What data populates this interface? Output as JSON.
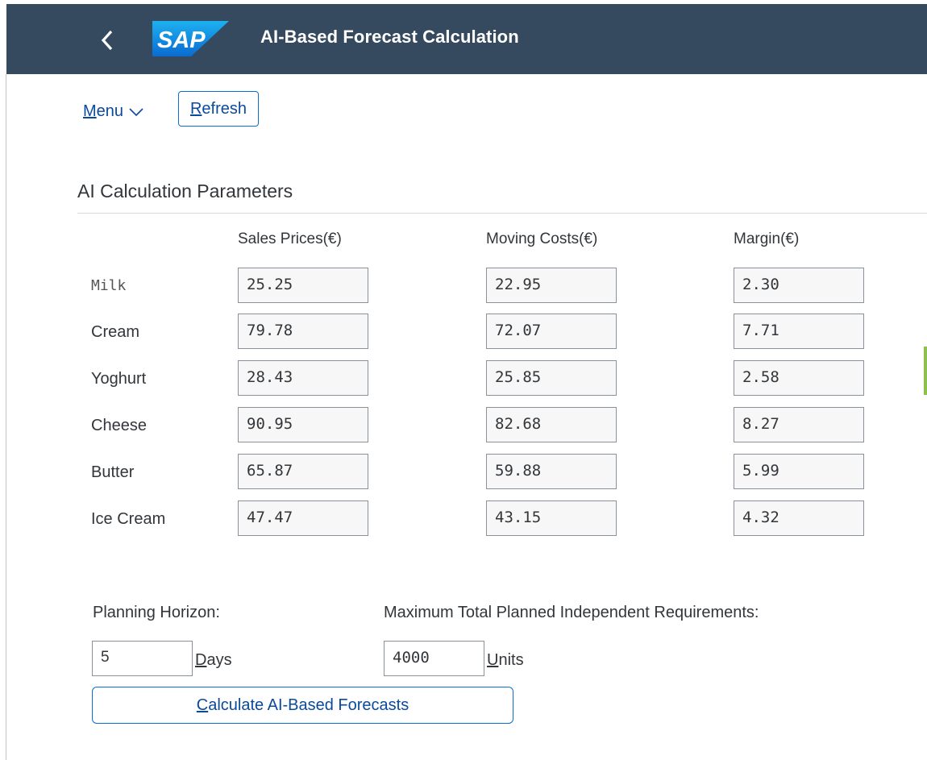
{
  "shell": {
    "title": "AI-Based Forecast Calculation",
    "logo_text": "SAP",
    "back_icon": "chevron-left-icon",
    "bg_color": "#354a5f"
  },
  "toolbar": {
    "menu_label": "Menu",
    "menu_icon": "chevron-down-icon",
    "refresh_label": "Refresh"
  },
  "section": {
    "title": "AI Calculation Parameters"
  },
  "table": {
    "columns": [
      "Sales Prices(€)",
      "Moving Costs(€)",
      "Margin(€)"
    ],
    "rows": [
      {
        "label": "Milk",
        "sales": "25.25",
        "costs": "22.95",
        "margin": "2.30"
      },
      {
        "label": "Cream",
        "sales": "79.78",
        "costs": "72.07",
        "margin": "7.71"
      },
      {
        "label": "Yoghurt",
        "sales": "28.43",
        "costs": "25.85",
        "margin": "2.58"
      },
      {
        "label": "Cheese",
        "sales": "90.95",
        "costs": "82.68",
        "margin": "8.27"
      },
      {
        "label": "Butter",
        "sales": "65.87",
        "costs": "59.88",
        "margin": "5.99"
      },
      {
        "label": "Ice Cream",
        "sales": "47.47",
        "costs": "43.15",
        "margin": "4.32"
      }
    ]
  },
  "planning": {
    "horizon_label": "Planning Horizon:",
    "horizon_value": "5",
    "horizon_unit": "Days",
    "max_label": "Maximum Total Planned Independent Requirements:",
    "max_value": "4000",
    "max_unit": "Units"
  },
  "actions": {
    "calculate_label": "Calculate AI-Based Forecasts"
  }
}
